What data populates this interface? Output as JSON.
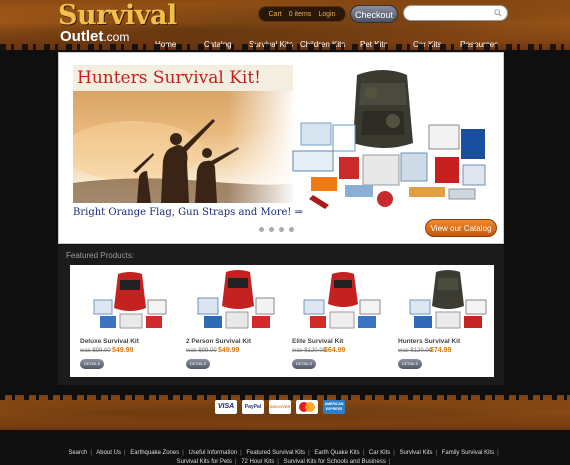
{
  "logo": {
    "top": "Survival",
    "bottom": "Outlet",
    "suffix": ".com"
  },
  "cart": {
    "label": "Cart",
    "items": "0 items",
    "login": "Login"
  },
  "checkout_label": "Checkout",
  "search": {
    "placeholder": ""
  },
  "nav": [
    "Home",
    "Catalog",
    "Survival Kits",
    "Children Kits",
    "Pet Kits",
    "Car Kits",
    "Resources"
  ],
  "hero": {
    "title": "Hunters Survival Kit!",
    "caption": "Bright Orange Flag, Gun Straps and More! ⇒",
    "cta": "View our Catalog",
    "slide_count": 4
  },
  "featured": {
    "heading": "Featured Products:",
    "products": [
      {
        "name": "Deluxe Survival Kit",
        "was": "was $99.00",
        "now": "$49.99",
        "details": "DETAILS"
      },
      {
        "name": "2 Person Survival Kit",
        "was": "was $99.00",
        "now": "$49.99",
        "details": "DETAILS"
      },
      {
        "name": "Elite Survival Kit",
        "was": "was $120.00",
        "now": "$64.99",
        "details": "DETAILS"
      },
      {
        "name": "Hunters Survival Kit",
        "was": "was $120.00",
        "now": "$74.99",
        "details": "DETAILS"
      }
    ]
  },
  "payment_cards": [
    "VISA",
    "PayPal",
    "DISCOVER",
    "MasterCard",
    "AMERICAN EXPRESS"
  ],
  "footer_links_row1": [
    "Search",
    "About Us",
    "Earthquake Zones",
    "Useful Information",
    "Featured Survival Kits",
    "Earth Quake Kits",
    "Car Kits",
    "Survival Kits",
    "Family Survival Kits"
  ],
  "footer_links_row2": [
    "Survival Kits for Pets",
    "72 Hour Kits",
    "Survival Kits for Schools and Business"
  ]
}
